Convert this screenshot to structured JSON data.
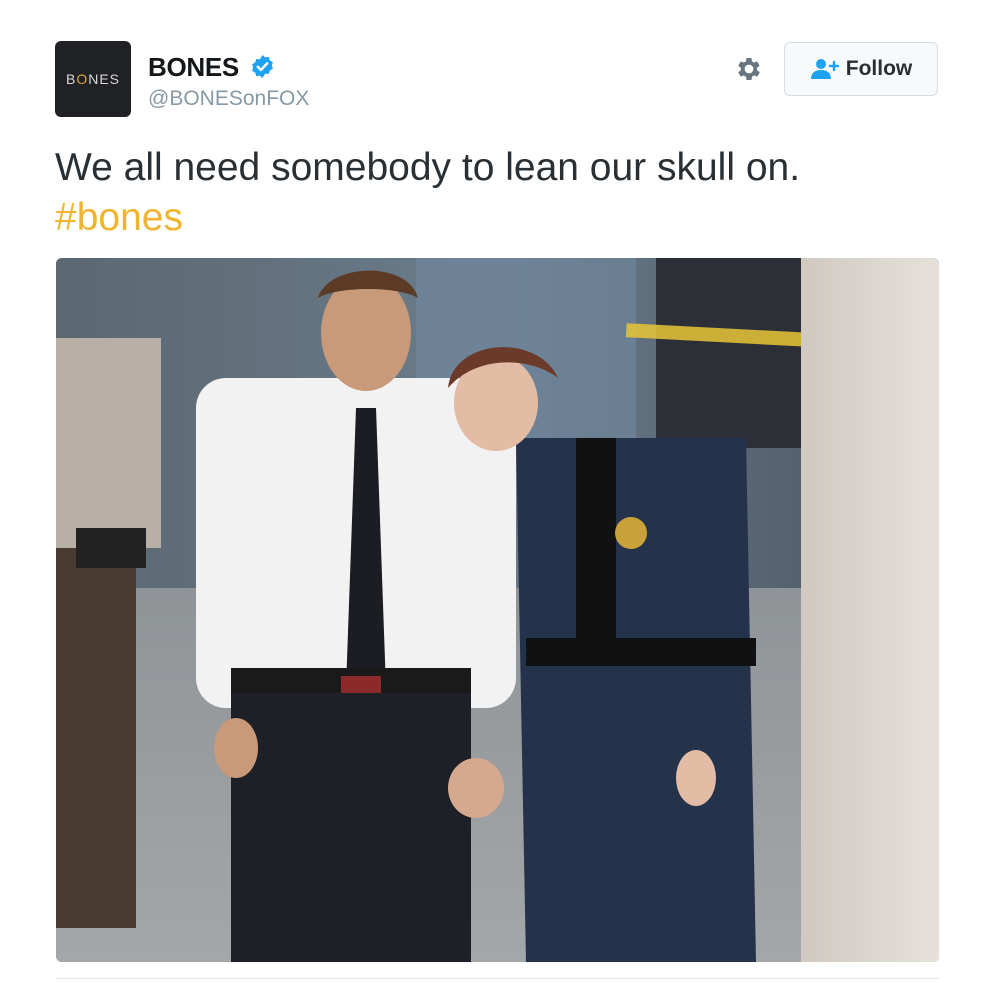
{
  "account": {
    "avatar_text": "BONES",
    "name": "BONES",
    "verified": true,
    "handle": "@BONESonFOX"
  },
  "actions": {
    "settings_icon": "gear-icon",
    "follow_label": "Follow",
    "follow_icon": "add-user-icon"
  },
  "tweet": {
    "text": "We all need somebody to lean our skull on.",
    "hashtag": "#bones"
  },
  "colors": {
    "hashtag": "#f0b42e",
    "verified": "#1da1f2",
    "handle": "#8899a6"
  }
}
